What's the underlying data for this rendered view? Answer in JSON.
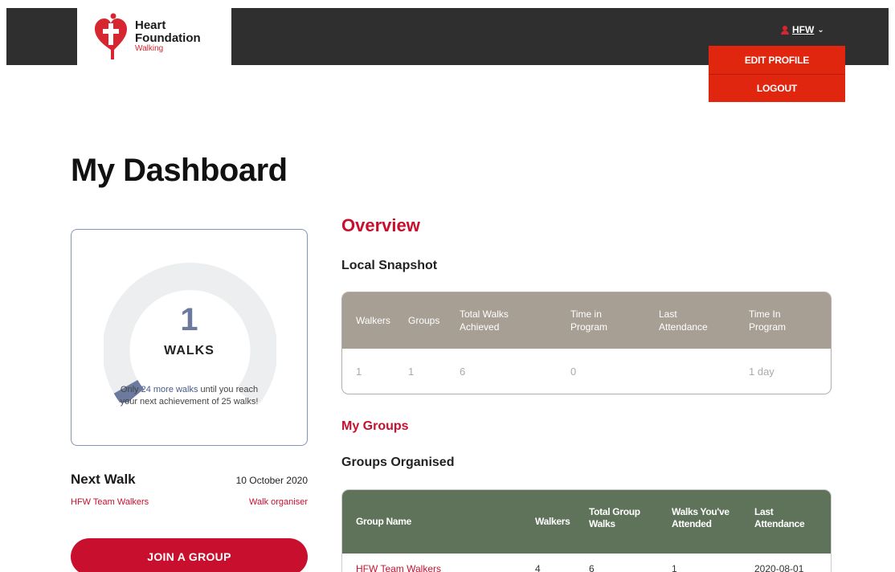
{
  "brand": {
    "line1": "Heart",
    "line2": "Foundation",
    "line3": "Walking",
    "color": "#d6262f"
  },
  "user": {
    "name": "HFW",
    "menu": [
      "EDIT PROFILE",
      "LOGOUT"
    ]
  },
  "page_title": "My Dashboard",
  "walk_card": {
    "count": "1",
    "unit": "WALKS",
    "msg_prefix": "Only ",
    "msg_highlight": "24 more walks",
    "msg_suffix": " until you reach",
    "msg_line2": "your next achievement of 25 walks!",
    "progress_fraction": 0.04
  },
  "next_walk": {
    "title": "Next Walk",
    "date": "10 October 2020",
    "group": "HFW Team Walkers",
    "role": "Walk organiser"
  },
  "join_button": "JOIN A GROUP",
  "overview": {
    "heading": "Overview",
    "subheading": "Local Snapshot",
    "columns": [
      "Walkers",
      "Groups",
      "Total Walks\nAchieved",
      "Time in\nProgram",
      "Last\nAttendance",
      "Time In\nProgram"
    ],
    "values": [
      "1",
      "1",
      "6",
      "0",
      "",
      "1 day"
    ]
  },
  "my_groups": {
    "heading": "My Groups",
    "subheading": "Groups Organised",
    "columns": [
      "Group Name",
      "Walkers",
      "Total Group\nWalks",
      "Walks You've\nAttended",
      "Last\nAttendance"
    ],
    "rows": [
      [
        "HFW Team Walkers",
        "4",
        "6",
        "1",
        "2020-08-01"
      ]
    ]
  },
  "colors": {
    "accent": "#c8102e",
    "dropdown": "#e0260f",
    "snapshot_header": "#a79e94",
    "groups_header": "#5f735b",
    "gauge_fill": "#6b7a9e"
  }
}
